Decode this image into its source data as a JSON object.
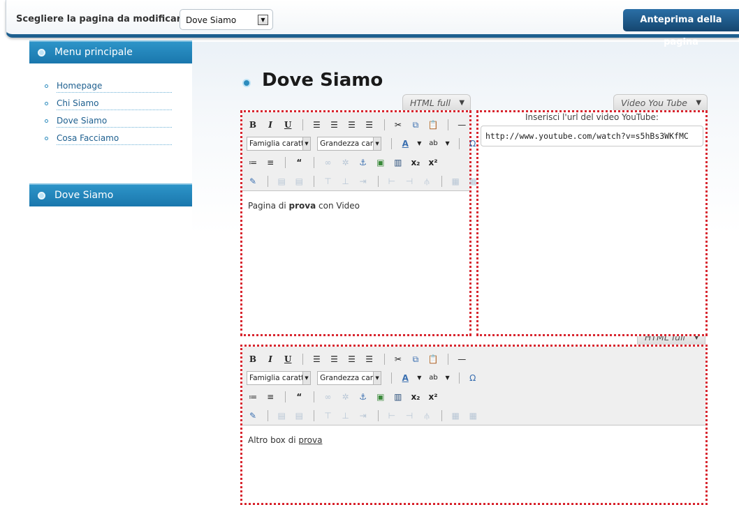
{
  "topbar": {
    "label": "Scegliere la pagina da modificare:",
    "page_select_value": "Dove Siamo",
    "preview_button": "Anteprima della pagina"
  },
  "sidebar": {
    "menu_title": "Menu principale",
    "items": [
      {
        "label": "Homepage"
      },
      {
        "label": "Chi Siamo"
      },
      {
        "label": "Dove Siamo"
      },
      {
        "label": "Cosa Facciamo"
      }
    ],
    "section_title": "Dove Siamo"
  },
  "main": {
    "page_title": "Dove Siamo",
    "box1": {
      "mode": "HTML full",
      "font_family": "Famiglia caratt",
      "font_size": "Grandezza car.",
      "content_prefix": "Pagina di ",
      "content_bold": "prova",
      "content_suffix": " con Video"
    },
    "box2": {
      "mode": "Video You Tube",
      "label": "Inserisci l'url del video YouTube:",
      "url_value": "http://www.youtube.com/watch?v=s5hBs3WKfMC"
    },
    "box3": {
      "mode": "HTML full",
      "font_family": "Famiglia caratt",
      "font_size": "Grandezza car.",
      "content_prefix": "Altro box di ",
      "content_underlined": "prova"
    }
  },
  "colors": {
    "accent": "#1a77ad",
    "topbar_border": "#1d5f8f",
    "box_border": "#d8262f"
  }
}
